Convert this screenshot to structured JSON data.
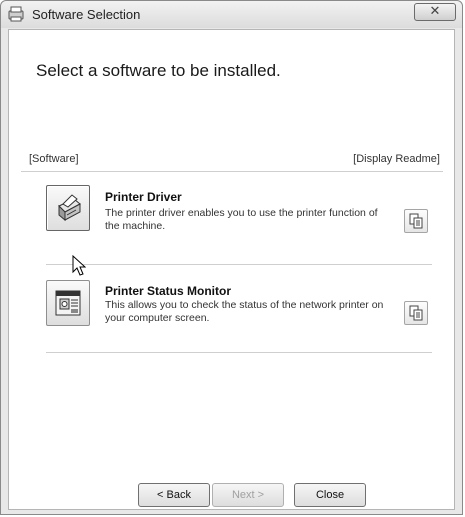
{
  "window": {
    "title": "Software Selection",
    "close_glyph": "✕"
  },
  "main": {
    "heading": "Select a software to be installed.",
    "software_label": "[Software]",
    "readme_label": "[Display Readme]",
    "items": [
      {
        "title": "Printer Driver",
        "description": "The printer driver enables you to use the printer function of the machine.",
        "icon": "printer-icon",
        "readme_icon": "document-icon"
      },
      {
        "title": "Printer Status Monitor",
        "description": "This allows you to check the status of the network printer on your computer screen.",
        "icon": "status-monitor-icon",
        "readme_icon": "document-icon"
      }
    ]
  },
  "footer": {
    "back_label": "< Back",
    "next_label": "Next >",
    "close_label": "Close"
  }
}
